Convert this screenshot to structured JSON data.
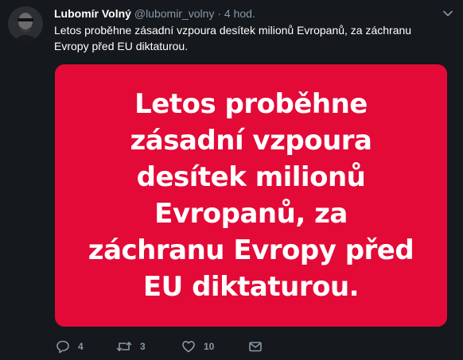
{
  "tweet": {
    "author_name": "Lubomír Volný",
    "handle": "@lubomir_volny",
    "separator": "·",
    "time": "4 hod.",
    "text": "Letos proběhne zásadní vzpoura desítek milionů Evropanů, za záchranu Evropy před EU diktaturou.",
    "media_text": "Letos proběhne zásadní vzpoura desítek milionů Evropanů, za záchranu Evropy před EU diktaturou.",
    "media_color": "#e30a37"
  },
  "actions": {
    "reply_icon": "reply-icon",
    "reply_count": "4",
    "retweet_icon": "retweet-icon",
    "retweet_count": "3",
    "like_icon": "heart-icon",
    "like_count": "10",
    "dm_icon": "envelope-icon"
  },
  "menu": {
    "icon": "chevron-down-icon"
  }
}
